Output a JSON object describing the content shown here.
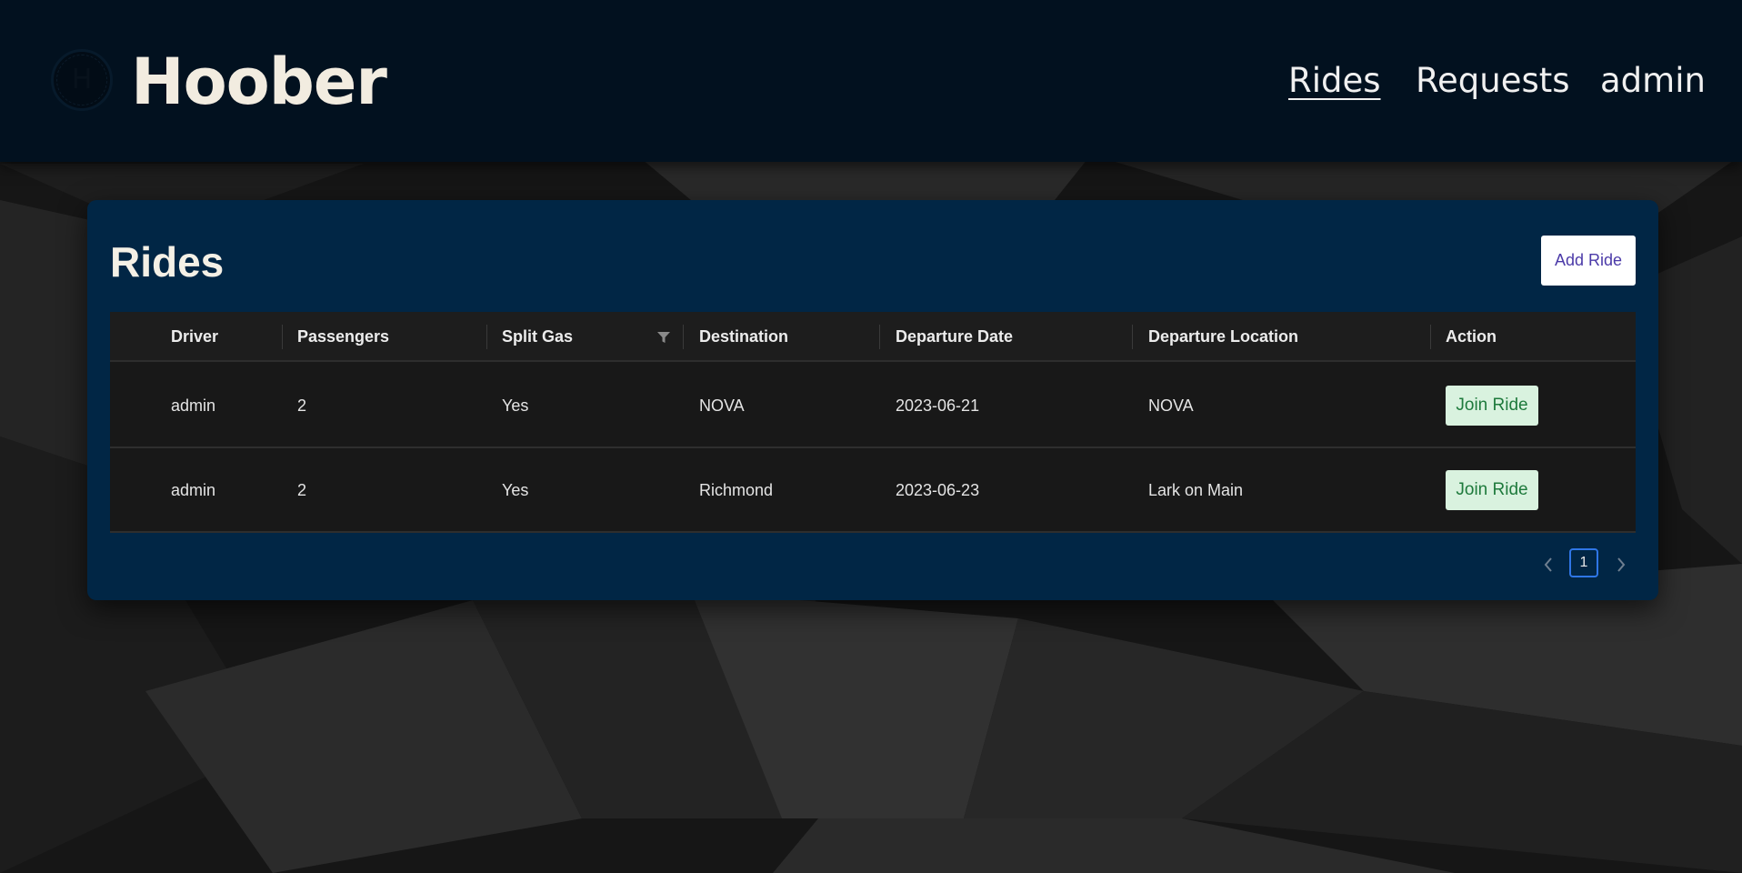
{
  "header": {
    "logo_letter": "H",
    "brand": "Hoober",
    "nav": [
      {
        "label": "Rides",
        "active": true
      },
      {
        "label": "Requests",
        "active": false
      },
      {
        "label": "admin",
        "active": false
      }
    ]
  },
  "card": {
    "title": "Rides",
    "add_button_label": "Add Ride",
    "columns": [
      "Driver",
      "Passengers",
      "Split Gas",
      "Destination",
      "Departure Date",
      "Departure Location",
      "Action"
    ],
    "rows": [
      {
        "driver": "admin",
        "passengers": "2",
        "split_gas": "Yes",
        "destination": "NOVA",
        "departure_date": "2023-06-21",
        "departure_location": "NOVA",
        "action": "Join Ride"
      },
      {
        "driver": "admin",
        "passengers": "2",
        "split_gas": "Yes",
        "destination": "Richmond",
        "departure_date": "2023-06-23",
        "departure_location": "Lark on Main",
        "action": "Join Ride"
      }
    ],
    "pagination": {
      "current_page": "1"
    }
  },
  "colors": {
    "header_bg": "#02111f",
    "card_bg": "#012645",
    "table_bg": "#181818",
    "join_button_bg": "#d9f2df",
    "join_button_text": "#1e7a3c",
    "add_button_text": "#4b3aa8",
    "pagination_border": "#2f76e6"
  }
}
